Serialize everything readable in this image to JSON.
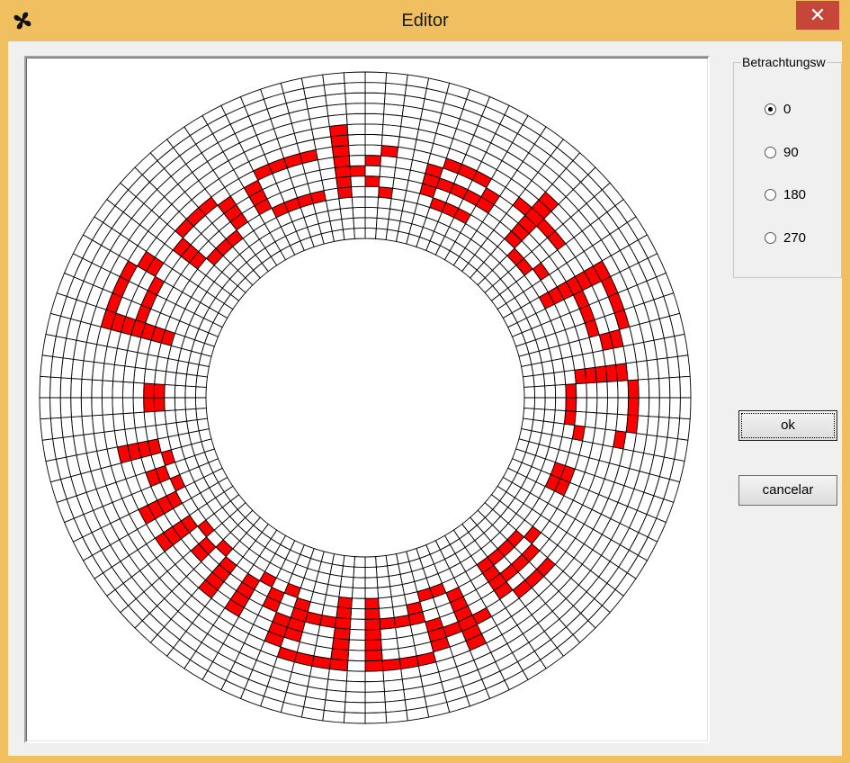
{
  "window": {
    "title": "Editor",
    "close_glyph": "✕",
    "app_icon": "propeller-icon",
    "frame_color": "#f0c060",
    "close_color": "#c7463a"
  },
  "ring_editor": {
    "rings": 16,
    "segments": 96,
    "fill_color": "#ff0000",
    "grid_color": "#000000",
    "letters": [
      "www.",
      "PocketPC",
      ".at",
      "db"
    ]
  },
  "view_group": {
    "legend": "Betrachtungsw",
    "options": [
      {
        "label": "0",
        "checked": true
      },
      {
        "label": "90",
        "checked": false
      },
      {
        "label": "180",
        "checked": false
      },
      {
        "label": "270",
        "checked": false
      }
    ]
  },
  "buttons": {
    "ok_label": "ok",
    "cancel_label": "cancelar"
  }
}
